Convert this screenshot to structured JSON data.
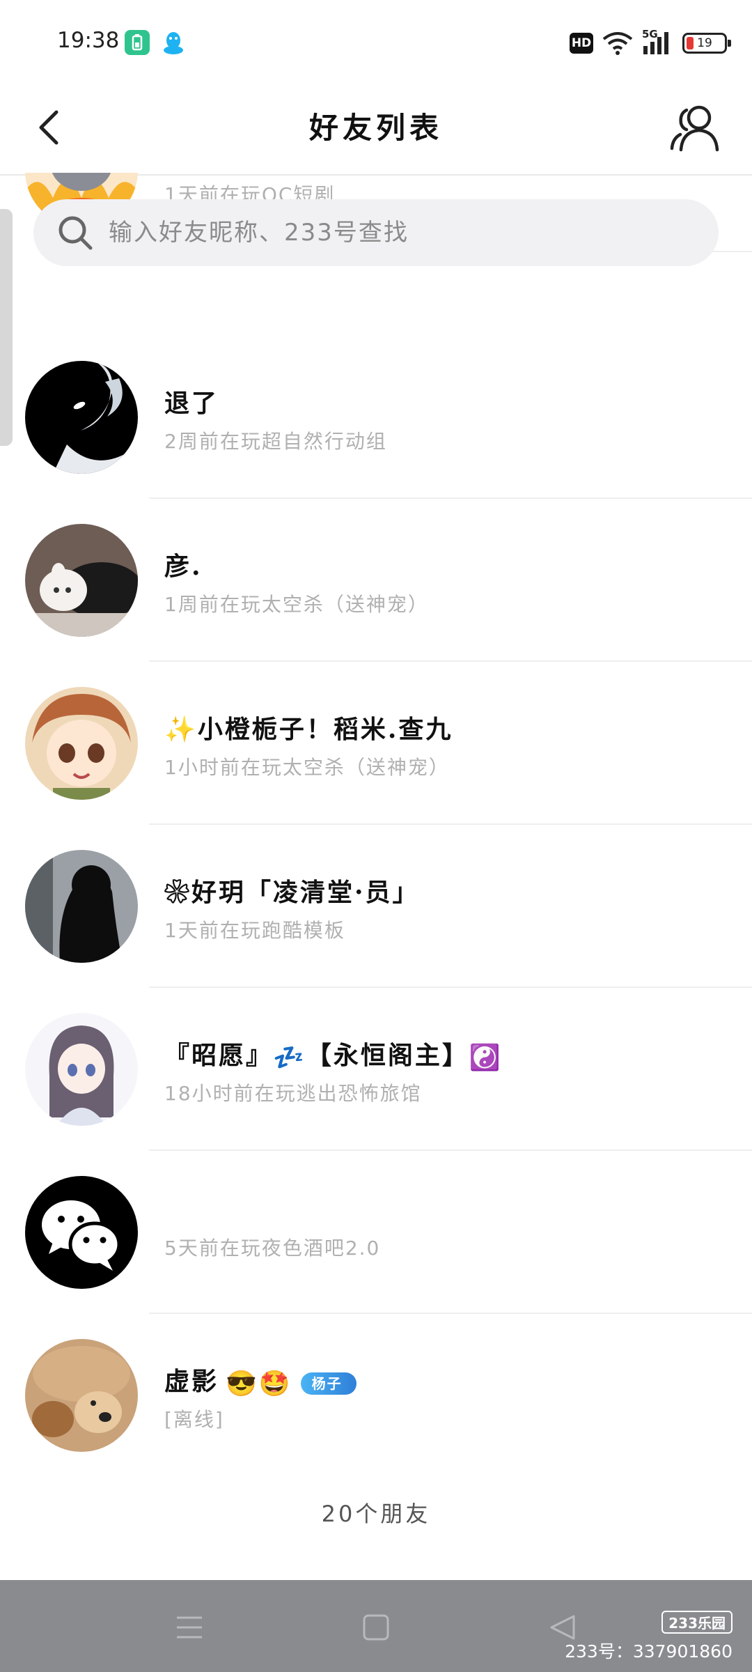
{
  "status_bar": {
    "time": "19:38",
    "network": "5G",
    "hd": "HD",
    "battery": "19",
    "icons": [
      "battery-saver-icon",
      "qq-icon",
      "wifi-icon",
      "signal-icon"
    ]
  },
  "header": {
    "title": "好友列表",
    "back_icon": "chevron-left-icon",
    "friends_icon": "friends-icon"
  },
  "search": {
    "placeholder": "输入好友昵称、233号查找",
    "value": ""
  },
  "friends": [
    {
      "name": "",
      "status": "1天前在玩OC短剧"
    },
    {
      "name": "退了",
      "status": "2周前在玩超自然行动组"
    },
    {
      "name": "彦.",
      "status": "1周前在玩太空杀（送神宠）"
    },
    {
      "name": "✨小橙栀子！稻米.查九",
      "status": "1小时前在玩太空杀（送神宠）"
    },
    {
      "name": "❀好玥「凌清堂·员」",
      "status": "1天前在玩跑酷模板"
    },
    {
      "name": "『昭愿』",
      "name_emoji": "💤",
      "name_suffix": "【永恒阁主】",
      "name_emoji_2": "☯️",
      "status": "18小时前在玩逃出恐怖旅馆"
    },
    {
      "name": "",
      "status": "5天前在玩夜色酒吧2.0"
    },
    {
      "name": "虚影",
      "name_emoji": "😎🤩",
      "badge": "杨子",
      "status": "[离线]"
    }
  ],
  "footer": {
    "count": "20个朋友"
  },
  "navbar": {
    "icons": [
      "menu-icon",
      "home-icon",
      "back-icon"
    ]
  },
  "watermark": {
    "logo": "233乐园",
    "text": "233号：337901860"
  },
  "colors": {
    "accent_badge": "#3aa0ee",
    "status_text": "#b0b0b0",
    "navbar": "#8a8b8f",
    "search_bg": "#f1f1f3"
  }
}
